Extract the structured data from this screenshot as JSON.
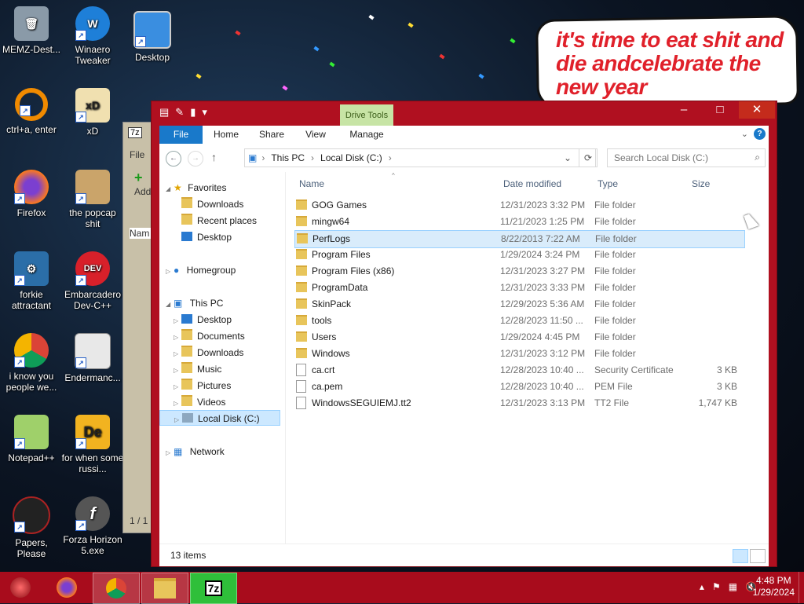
{
  "desktop": {
    "icons": [
      {
        "label": "MEMZ-Dest...",
        "icon": "recycle-bin-icon"
      },
      {
        "label": "Winaero Tweaker",
        "icon": "winaero-icon"
      },
      {
        "label": "Desktop",
        "icon": "monitor-icon"
      },
      {
        "label": "ctrl+a, enter",
        "icon": "ring-icon"
      },
      {
        "label": "xD",
        "icon": "xd-icon"
      },
      {
        "label": "Firefox",
        "icon": "firefox-icon"
      },
      {
        "label": "the popcap shit",
        "icon": "popcap-icon"
      },
      {
        "label": "forkie attractant",
        "icon": "gear-icon"
      },
      {
        "label": "Embarcadero Dev-C++",
        "icon": "devcpp-icon"
      },
      {
        "label": "i know you people we...",
        "icon": "chrome-icon"
      },
      {
        "label": "Endermanc...",
        "icon": "window-icon"
      },
      {
        "label": "Notepad++",
        "icon": "notepad-icon"
      },
      {
        "label": "for when some russi...",
        "icon": "de-icon"
      },
      {
        "label": "Papers, Please",
        "icon": "papers-icon"
      },
      {
        "label": "Forza Horizon 5.exe",
        "icon": "flash-icon"
      }
    ],
    "wallpaper_text": "it's time to eat shit and die andcelebrate the new year"
  },
  "window": {
    "context_tab": "Drive Tools",
    "ribbon_tabs": [
      "File",
      "Home",
      "Share",
      "View",
      "Manage"
    ],
    "breadcrumb": [
      "This PC",
      "Local Disk (C:)"
    ],
    "search_placeholder": "Search Local Disk (C:)",
    "nav": {
      "favorites": "Favorites",
      "favorites_items": [
        "Downloads",
        "Recent places",
        "Desktop"
      ],
      "homegroup": "Homegroup",
      "thispc": "This PC",
      "thispc_items": [
        "Desktop",
        "Documents",
        "Downloads",
        "Music",
        "Pictures",
        "Videos",
        "Local Disk (C:)"
      ],
      "network": "Network"
    },
    "columns": {
      "name": "Name",
      "date": "Date modified",
      "type": "Type",
      "size": "Size"
    },
    "files": [
      {
        "name": "GOG Games",
        "date": "12/31/2023 3:32 PM",
        "type": "File folder",
        "size": "",
        "kind": "dir"
      },
      {
        "name": "mingw64",
        "date": "11/21/2023 1:25 PM",
        "type": "File folder",
        "size": "",
        "kind": "dir"
      },
      {
        "name": "PerfLogs",
        "date": "8/22/2013 7:22 AM",
        "type": "File folder",
        "size": "",
        "kind": "dir"
      },
      {
        "name": "Program Files",
        "date": "1/29/2024 3:24 PM",
        "type": "File folder",
        "size": "",
        "kind": "dir"
      },
      {
        "name": "Program Files (x86)",
        "date": "12/31/2023 3:27 PM",
        "type": "File folder",
        "size": "",
        "kind": "dir"
      },
      {
        "name": "ProgramData",
        "date": "12/31/2023 3:33 PM",
        "type": "File folder",
        "size": "",
        "kind": "dir"
      },
      {
        "name": "SkinPack",
        "date": "12/29/2023 5:36 AM",
        "type": "File folder",
        "size": "",
        "kind": "dir"
      },
      {
        "name": "tools",
        "date": "12/28/2023 11:50 ...",
        "type": "File folder",
        "size": "",
        "kind": "dir"
      },
      {
        "name": "Users",
        "date": "1/29/2024 4:45 PM",
        "type": "File folder",
        "size": "",
        "kind": "dir"
      },
      {
        "name": "Windows",
        "date": "12/31/2023 3:12 PM",
        "type": "File folder",
        "size": "",
        "kind": "dir"
      },
      {
        "name": "ca.crt",
        "date": "12/28/2023 10:40 ...",
        "type": "Security Certificate",
        "size": "3 KB",
        "kind": "file"
      },
      {
        "name": "ca.pem",
        "date": "12/28/2023 10:40 ...",
        "type": "PEM File",
        "size": "3 KB",
        "kind": "file"
      },
      {
        "name": "WindowsSEGUIEMJ.tt2",
        "date": "12/31/2023 3:13 PM",
        "type": "TT2 File",
        "size": "1,747 KB",
        "kind": "file"
      }
    ],
    "status": "13 items"
  },
  "bg_window": {
    "title": "7z",
    "file_menu": "File",
    "add": "Add",
    "name_col": "Nam",
    "count": "1 / 1"
  },
  "taskbar": {
    "time": "4:48 PM",
    "date": "1/29/2024",
    "apps": [
      "firefox-icon",
      "chrome-icon",
      "explorer-icon",
      "7zip-icon"
    ]
  },
  "colors": {
    "window_frame": "#b01020",
    "taskbar": "#a80c1c",
    "selection": "#cce8ff",
    "file_tab": "#1979ca",
    "bubble_text": "#e0202a"
  }
}
